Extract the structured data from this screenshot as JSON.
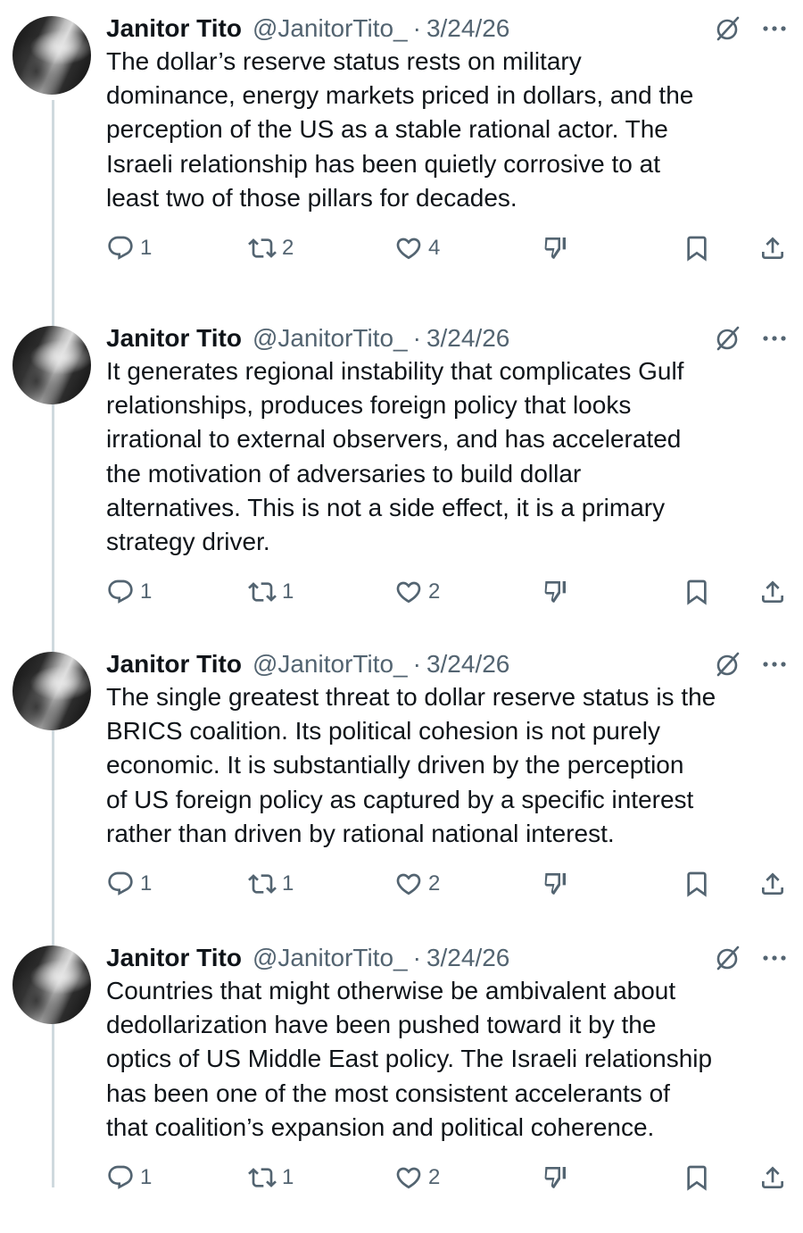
{
  "author": {
    "name": "Janitor Tito",
    "handle": "@JanitorTito_",
    "separator": "·"
  },
  "colors": {
    "text": "#0f1419",
    "secondary": "#536471",
    "thread_line": "#cfd9de"
  },
  "icons": [
    "reply-icon",
    "retweet-icon",
    "like-icon",
    "dislike-icon",
    "bookmark-icon",
    "share-icon",
    "grok-icon",
    "more-icon"
  ],
  "tweets": [
    {
      "date": "3/24/26",
      "lines": [
        "The dollar’s reserve status rests on military",
        "dominance, energy markets priced in dollars, and the",
        "perception of the US as a stable rational actor. The",
        "Israeli relationship has been quietly corrosive to at",
        "least two of those pillars for decades."
      ],
      "replies": "1",
      "retweets": "2",
      "likes": "4"
    },
    {
      "date": "3/24/26",
      "lines": [
        "It generates regional instability that complicates Gulf",
        "relationships, produces foreign policy that looks",
        "irrational to external observers, and has accelerated",
        "the motivation of adversaries to build dollar",
        "alternatives. This is not a side effect, it is a primary",
        "strategy driver."
      ],
      "replies": "1",
      "retweets": "1",
      "likes": "2"
    },
    {
      "date": "3/24/26",
      "lines": [
        "The single greatest threat to dollar reserve status is the",
        "BRICS coalition. Its political cohesion is not purely",
        "economic. It is substantially driven by the perception",
        "of US foreign policy as captured by a specific interest",
        "rather than driven by rational national interest."
      ],
      "replies": "1",
      "retweets": "1",
      "likes": "2"
    },
    {
      "date": "3/24/26",
      "lines": [
        "Countries that might otherwise be ambivalent about",
        "dedollarization have been pushed toward it by the",
        "optics of US Middle East policy. The Israeli relationship",
        "has been one of the most consistent accelerants of",
        "that coalition’s expansion and political coherence."
      ],
      "replies": "1",
      "retweets": "1",
      "likes": "2"
    }
  ]
}
